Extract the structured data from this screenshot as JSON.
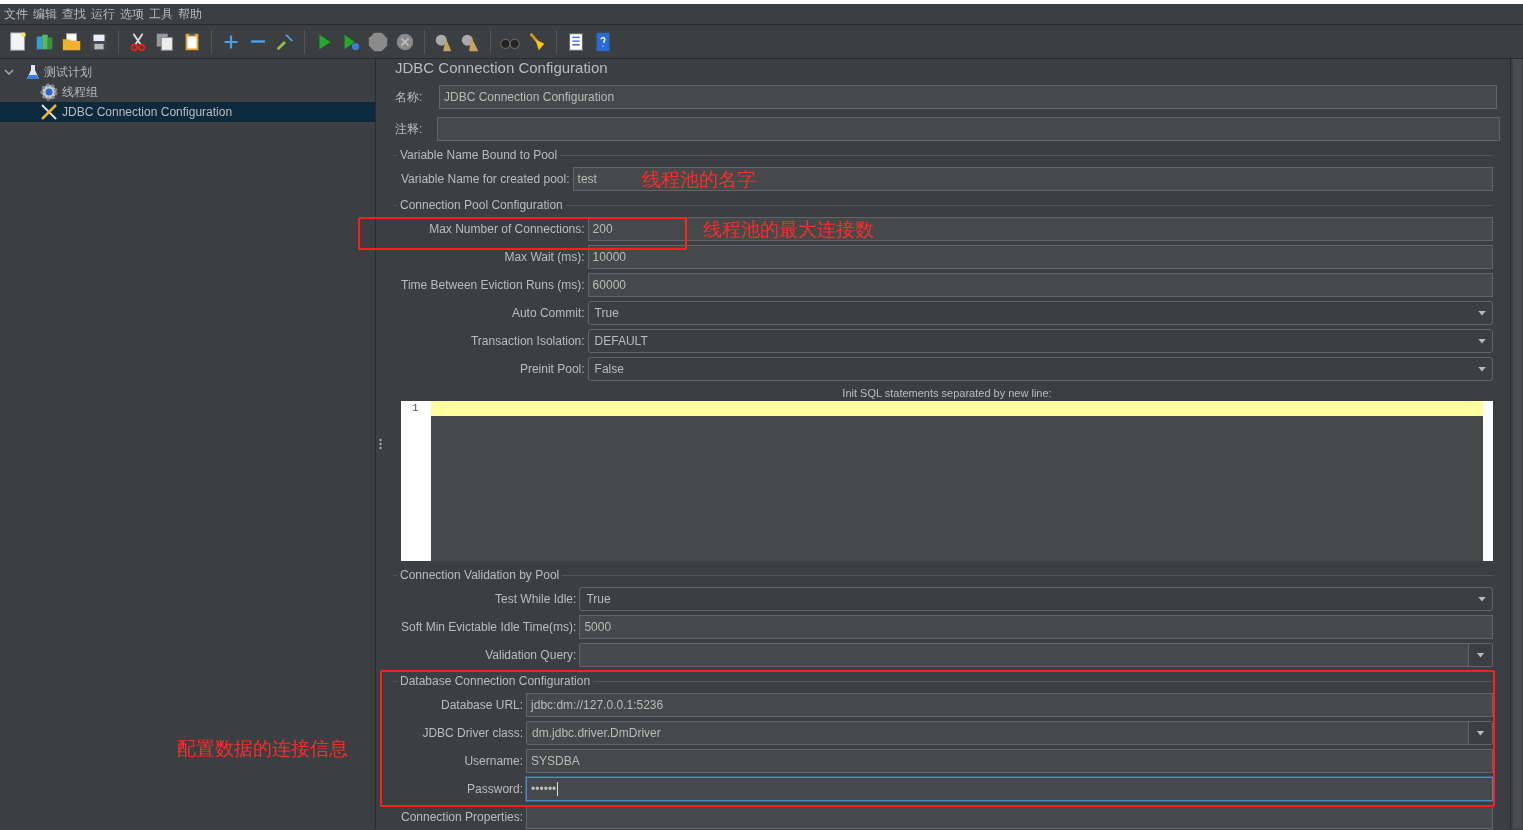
{
  "menu": [
    "文件",
    "编辑",
    "查找",
    "运行",
    "选项",
    "工具",
    "帮助"
  ],
  "tree": [
    {
      "label": "测试计划",
      "kind": "plan",
      "expanded": true,
      "selected": false,
      "children": [
        {
          "label": "线程组",
          "kind": "group",
          "selected": false
        },
        {
          "label": "JDBC Connection Configuration",
          "kind": "config",
          "selected": true
        }
      ]
    }
  ],
  "panel": {
    "title": "JDBC Connection Configuration",
    "name": {
      "label": "名称:",
      "value": "JDBC Connection Configuration"
    },
    "comment": {
      "label": "注释:"
    },
    "sections": [
      {
        "title": "Variable Name Bound to Pool",
        "rows": [
          {
            "label": "Variable Name for created pool:",
            "kind": "text",
            "value": "test",
            "note": "线程池的名字"
          }
        ]
      },
      {
        "title": "Connection Pool Configuration",
        "rows": [
          {
            "label": "Max Number of Connections:",
            "kind": "text",
            "value": "200",
            "note": "线程池的最大连接数"
          },
          {
            "label": "Max Wait (ms):",
            "kind": "text",
            "value": "10000"
          },
          {
            "label": "Time Between Eviction Runs (ms):",
            "kind": "text",
            "value": "60000"
          },
          {
            "label": "Auto Commit:",
            "kind": "select",
            "value": "True"
          },
          {
            "label": "Transaction Isolation:",
            "kind": "select",
            "value": "DEFAULT"
          },
          {
            "label": "Preinit Pool:",
            "kind": "select",
            "value": "False"
          }
        ],
        "editor": {
          "label": "Init SQL statements separated by new line:",
          "line_numbers": [
            "1"
          ]
        }
      },
      {
        "title": "Connection Validation by Pool",
        "rows": [
          {
            "label": "Test While Idle:",
            "kind": "select",
            "value": "True"
          },
          {
            "label": "Soft Min Evictable Idle Time(ms):",
            "kind": "text",
            "value": "5000"
          },
          {
            "label": "Validation Query:",
            "kind": "combo"
          }
        ]
      },
      {
        "title": "Database Connection Configuration",
        "rows": [
          {
            "label": "Database URL:",
            "kind": "text",
            "value": "jdbc:dm://127.0.0.1:5236"
          },
          {
            "label": "JDBC Driver class:",
            "kind": "combo",
            "value": "dm.jdbc.driver.DmDriver"
          },
          {
            "label": "Username:",
            "kind": "text",
            "value": "SYSDBA"
          },
          {
            "label": "Password:",
            "kind": "password",
            "value": "••••••",
            "focused": true
          },
          {
            "label": "Connection Properties:",
            "kind": "text"
          }
        ]
      }
    ]
  },
  "annotations": [
    {
      "kind": "box"
    },
    {
      "kind": "box"
    },
    {
      "kind": "note",
      "text": "配置数据的连接信息"
    }
  ]
}
